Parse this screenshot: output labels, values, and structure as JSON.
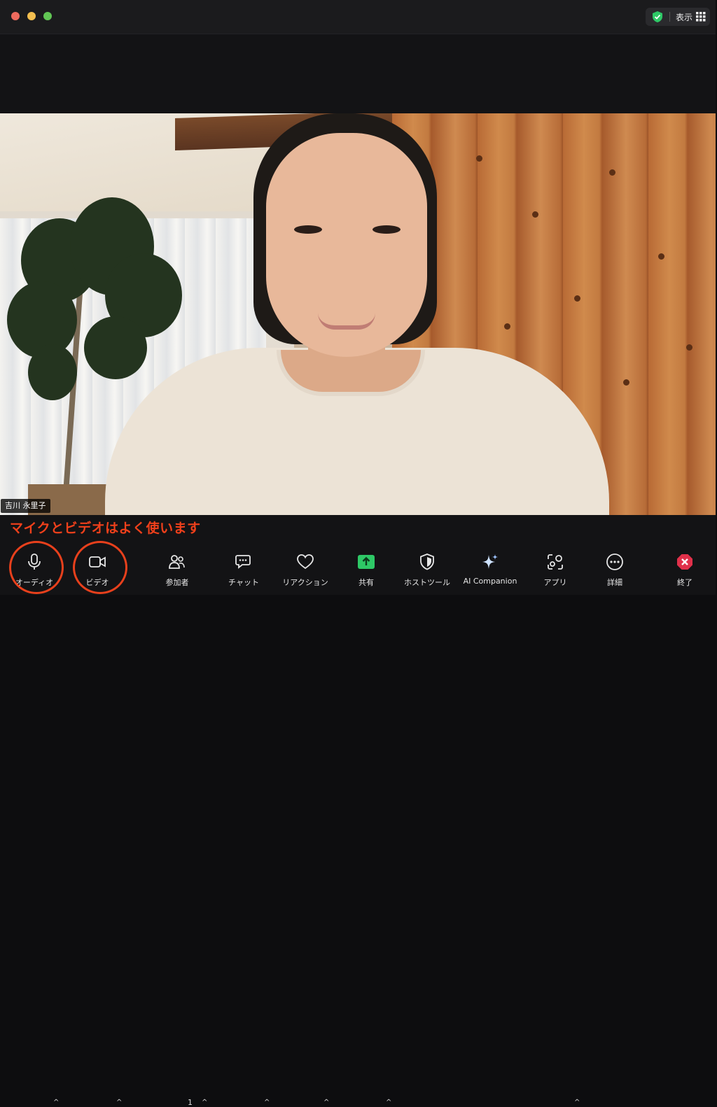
{
  "titlebar": {
    "view_label": "表示"
  },
  "video": {
    "participant_name": "吉川 永里子"
  },
  "annotation": {
    "text": "マイクとビデオはよく使います",
    "color": "#f0401b"
  },
  "toolbar": {
    "audio": {
      "label": "オーディオ",
      "icon": "microphone-icon"
    },
    "video": {
      "label": "ビデオ",
      "icon": "camera-icon"
    },
    "participants": {
      "label": "参加者",
      "count": "1",
      "icon": "participants-icon"
    },
    "chat": {
      "label": "チャット",
      "icon": "chat-icon"
    },
    "reactions": {
      "label": "リアクション",
      "icon": "heart-icon"
    },
    "share": {
      "label": "共有",
      "icon": "share-arrow-icon",
      "color": "#2ec866"
    },
    "host_tools": {
      "label": "ホストツール",
      "icon": "shield-icon"
    },
    "ai_companion": {
      "label": "AI Companion",
      "icon": "sparkle-icon"
    },
    "apps": {
      "label": "アプリ",
      "icon": "apps-icon"
    },
    "more": {
      "label": "詳細",
      "icon": "more-icon"
    },
    "end": {
      "label": "終了",
      "icon": "end-icon",
      "color": "#e0304a"
    }
  }
}
